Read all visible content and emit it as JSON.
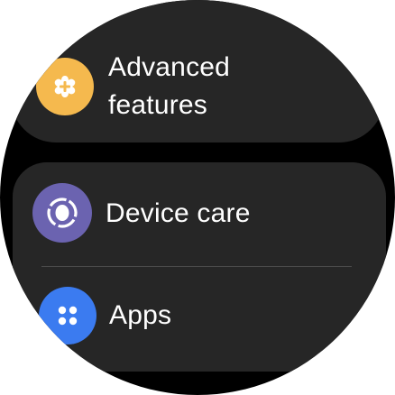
{
  "settings": {
    "items": [
      {
        "label_line1": "Advanced",
        "label_line2": "features",
        "icon": "advanced-features-icon",
        "color": "#F5B94E"
      },
      {
        "label": "Device care",
        "icon": "device-care-icon",
        "color": "#6B63B0"
      },
      {
        "label": "Apps",
        "icon": "apps-grid-icon",
        "color": "#3B7BF0"
      }
    ]
  }
}
